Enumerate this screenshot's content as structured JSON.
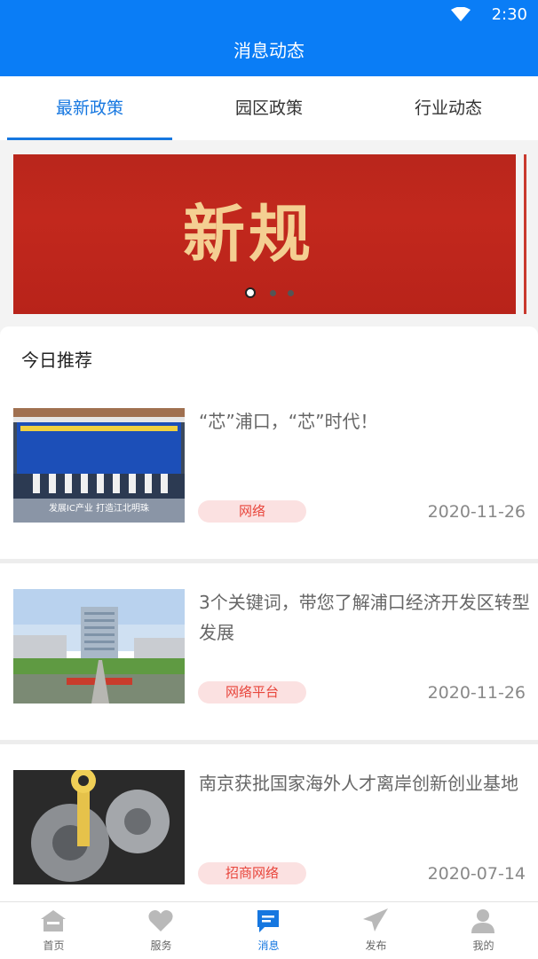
{
  "status": {
    "time": "2:30"
  },
  "appbar": {
    "title": "消息动态"
  },
  "tabs": [
    {
      "label": "最新政策",
      "active": true
    },
    {
      "label": "园区政策",
      "active": false
    },
    {
      "label": "行业动态",
      "active": false
    }
  ],
  "banner": {
    "text": "新规",
    "pages": 3,
    "current_page": 1
  },
  "section": {
    "title": "今日推荐"
  },
  "news": [
    {
      "title": "“芯”浦口，“芯”时代！",
      "tag": "网络",
      "date": "2020-11-26",
      "thumb_banner_text": "发展IC产业  打造江北明珠"
    },
    {
      "title": "3个关键词，带您了解浦口经济开发区转型发展",
      "tag": "网络平台",
      "date": "2020-11-26"
    },
    {
      "title": "南京获批国家海外人才离岸创新创业基地",
      "tag": "招商网络",
      "date": "2020-07-14"
    }
  ],
  "bottom_nav": [
    {
      "label": "首页",
      "icon": "home-icon",
      "active": false
    },
    {
      "label": "服务",
      "icon": "heart-icon",
      "active": false
    },
    {
      "label": "消息",
      "icon": "message-icon",
      "active": true
    },
    {
      "label": "发布",
      "icon": "send-icon",
      "active": false
    },
    {
      "label": "我的",
      "icon": "user-icon",
      "active": false
    }
  ],
  "colors": {
    "primary": "#0a7df6",
    "active_tab": "#1677e0",
    "tag_bg": "#fbe1e1",
    "tag_text": "#e8463c"
  }
}
